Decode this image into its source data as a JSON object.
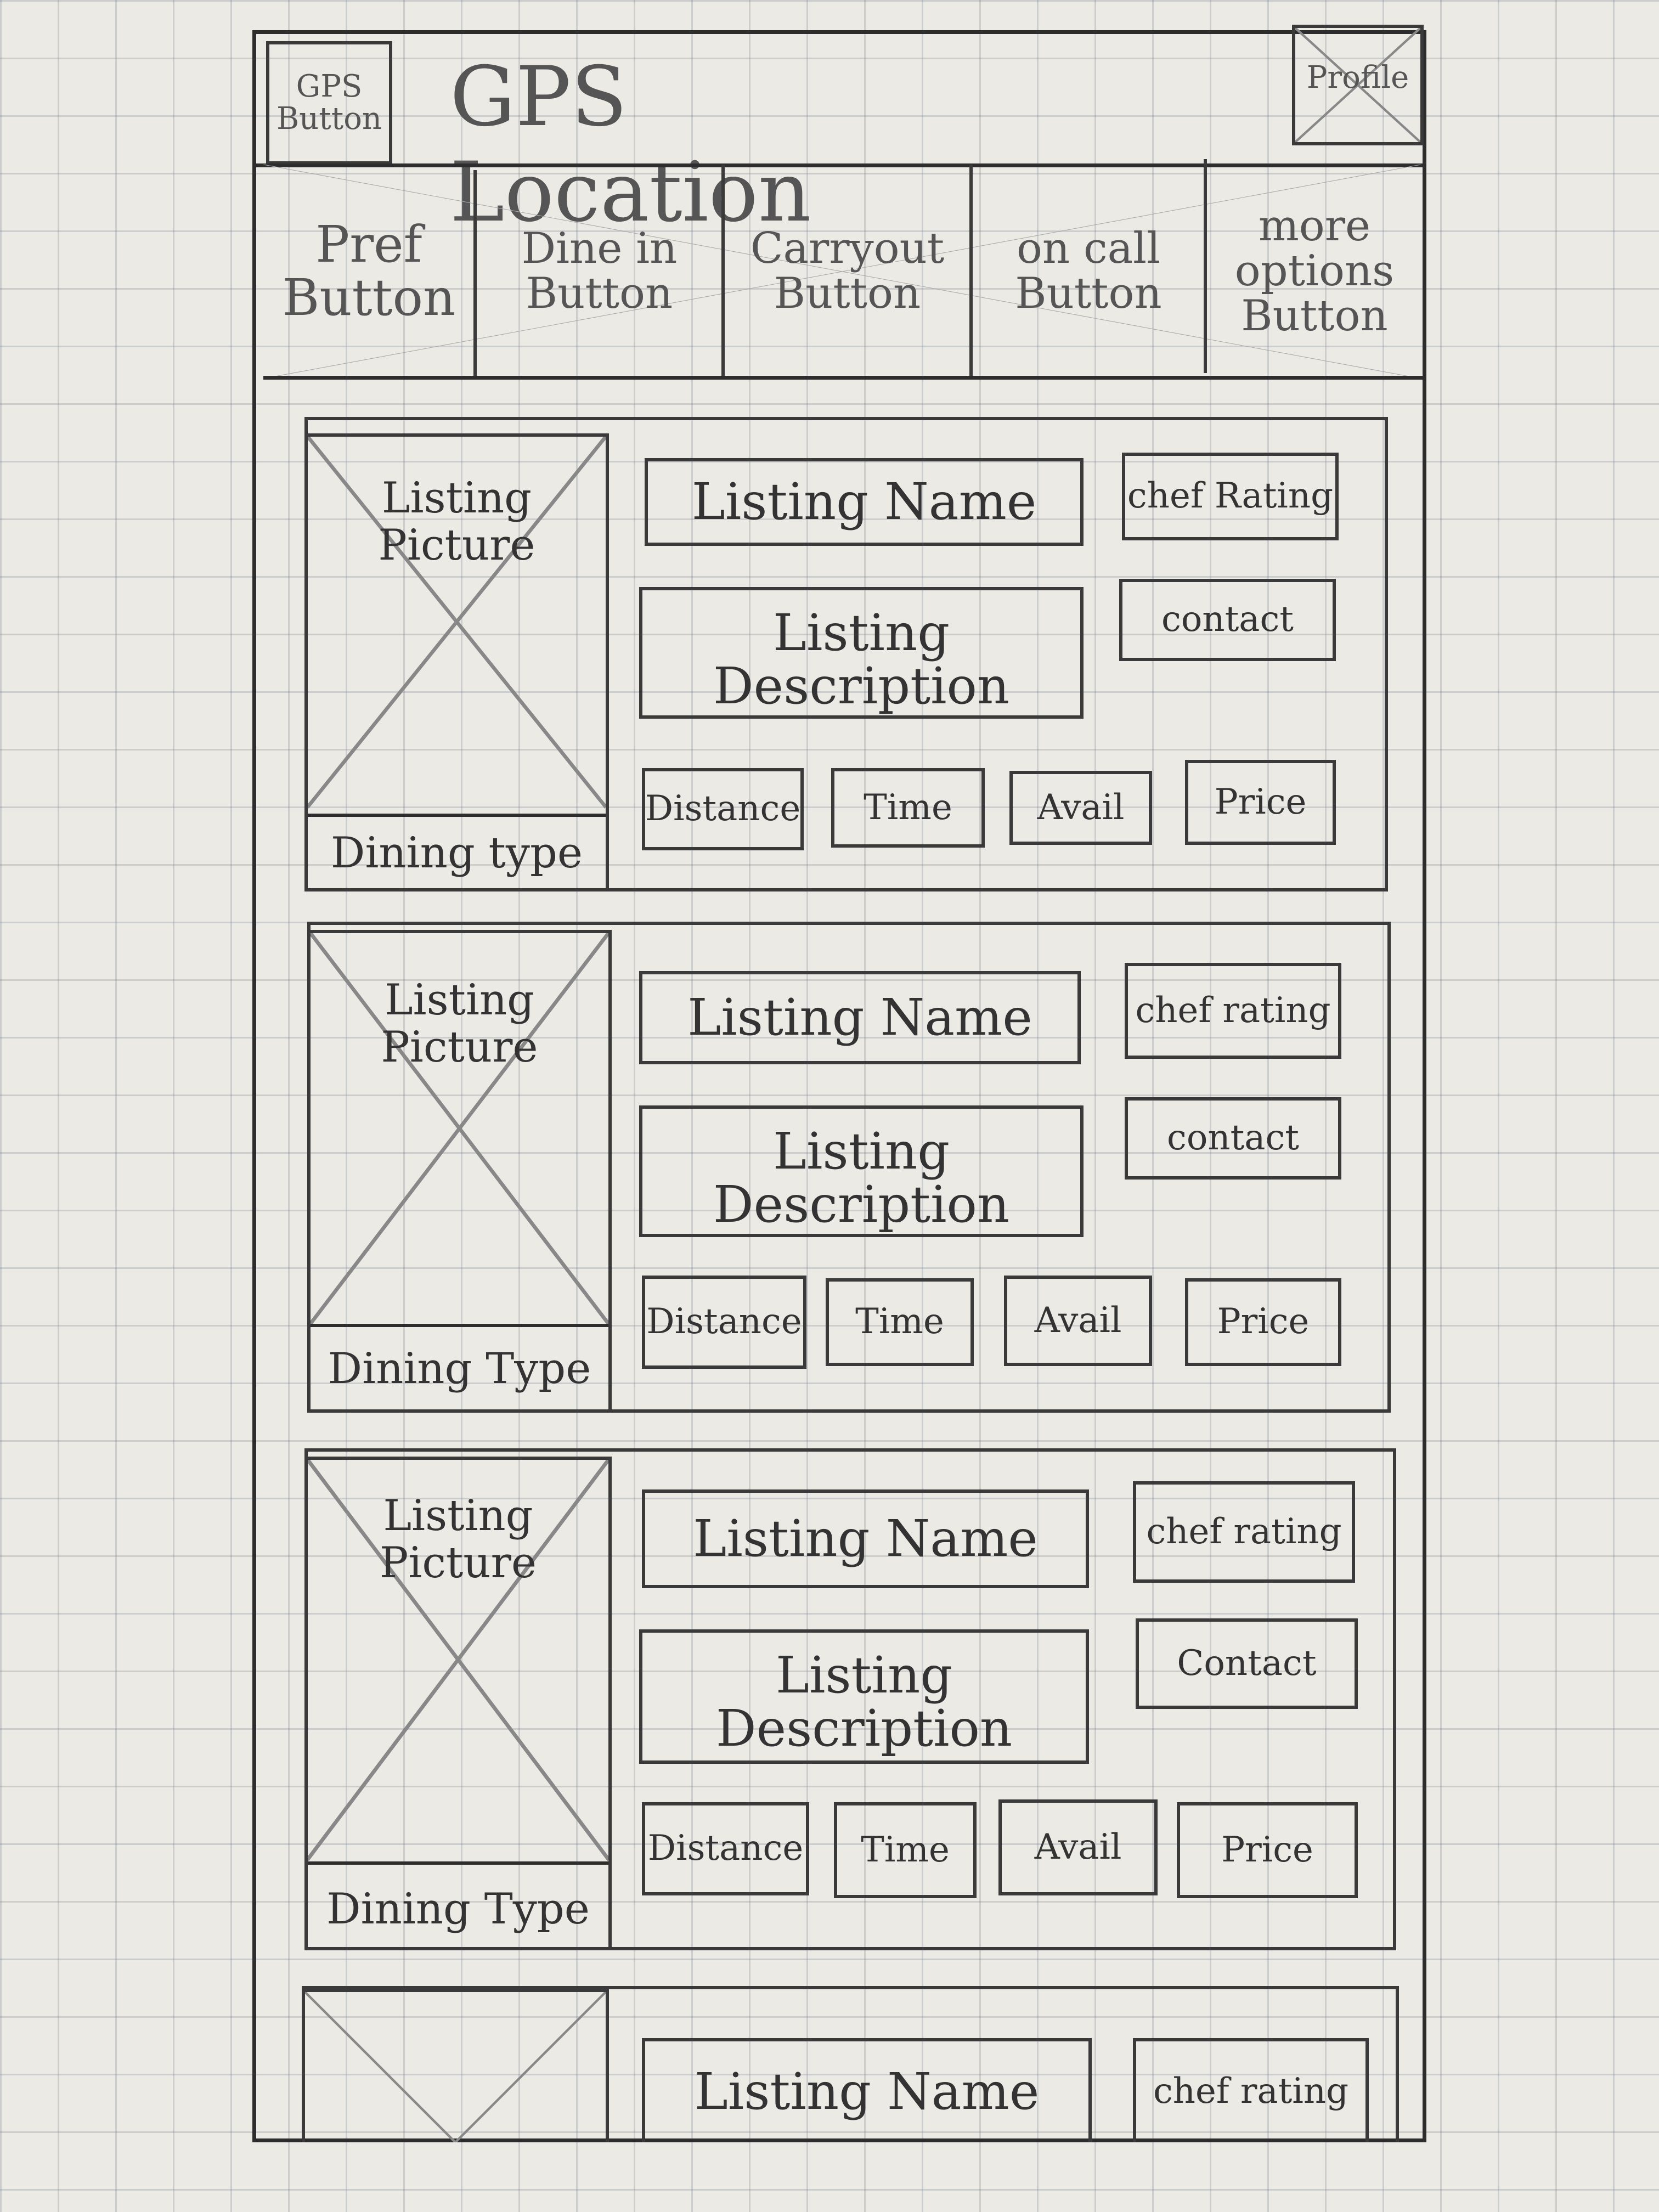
{
  "header": {
    "gps_button": "GPS Button",
    "title": "GPS Location",
    "profile": "Profile"
  },
  "options": [
    "Pref Button",
    "Dine in Button",
    "Carryout Button",
    "on call Button",
    "more options Button"
  ],
  "listings": [
    {
      "picture": "Listing Picture",
      "dining_type": "Dining type",
      "name": "Listing Name",
      "rating": "chef Rating",
      "description": "Listing Description",
      "contact": "contact",
      "distance": "Distance",
      "time": "Time",
      "avail": "Avail",
      "price": "Price"
    },
    {
      "picture": "Listing Picture",
      "dining_type": "Dining Type",
      "name": "Listing Name",
      "rating": "chef rating",
      "description": "Listing Description",
      "contact": "contact",
      "distance": "Distance",
      "time": "Time",
      "avail": "Avail",
      "price": "Price"
    },
    {
      "picture": "Listing Picture",
      "dining_type": "Dining Type",
      "name": "Listing Name",
      "rating": "chef rating",
      "description": "Listing Description",
      "contact": "Contact",
      "distance": "Distance",
      "time": "Time",
      "avail": "Avail",
      "price": "Price"
    },
    {
      "name": "Listing Name",
      "rating": "chef rating"
    }
  ]
}
